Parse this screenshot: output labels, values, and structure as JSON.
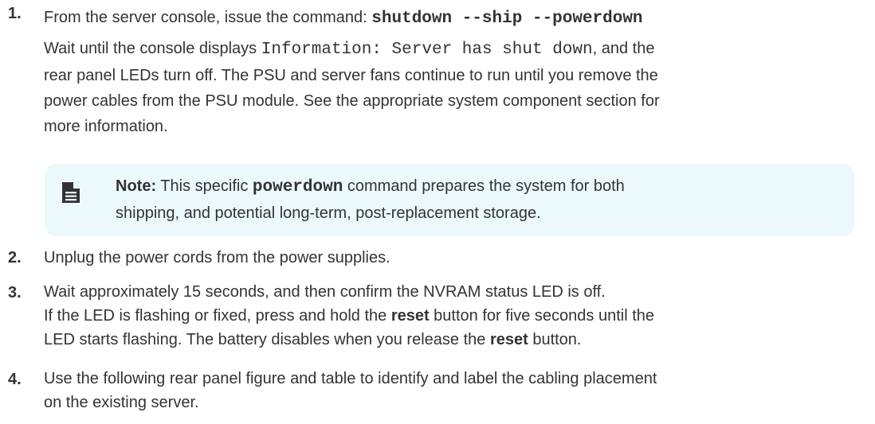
{
  "steps": [
    {
      "number": "1.",
      "cmd_prefix": "From the server console, issue the command: ",
      "cmd": "shutdown --ship --powerdown",
      "wait_prefix": "Wait until the console displays ",
      "console_msg": "Information: Server has shut down",
      "wait_suffix": ", and the",
      "lines": [
        "rear panel LEDs turn off. The PSU and server fans continue to run until you remove the",
        "power cables from the PSU module. See the appropriate system component section for",
        "more information."
      ]
    },
    {
      "number": "2.",
      "text": "Unplug the power cords from the power supplies."
    },
    {
      "number": "3.",
      "line1": "Wait approximately 15 seconds, and then confirm the NVRAM status LED is off.",
      "line2_prefix": "If the LED is flashing or fixed, press and hold the ",
      "bold_word": "reset",
      "line2_suffix": " button for five seconds until the",
      "line3_prefix": "LED starts flashing. The battery disables when you release the ",
      "line3_suffix": " button."
    },
    {
      "number": "4.",
      "lines": [
        "Use the following rear panel figure and table to identify and label the cabling placement",
        "on the existing server."
      ]
    }
  ],
  "note": {
    "icon": "note-icon",
    "label": "Note:",
    "pre": " This specific ",
    "code": "powerdown",
    "post": " command prepares the system for both",
    "line2": "shipping, and potential long-term, post-replacement storage."
  }
}
